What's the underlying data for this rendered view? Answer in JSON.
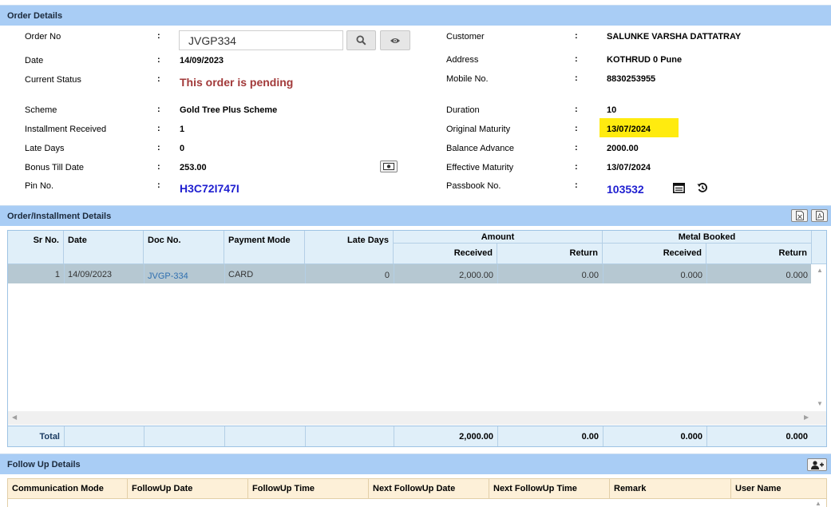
{
  "order_details": {
    "title": "Order Details",
    "order_no_label": "Order No",
    "order_no_value": "JVGP334",
    "date_label": "Date",
    "date_value": "14/09/2023",
    "status_label": "Current Status",
    "status_value": "This order is pending",
    "scheme_label": "Scheme",
    "scheme_value": "Gold Tree Plus Scheme",
    "installment_label": "Installment Received",
    "installment_value": "1",
    "late_days_label": "Late Days",
    "late_days_value": "0",
    "bonus_label": "Bonus Till Date",
    "bonus_value": "253.00",
    "pin_label": "Pin No.",
    "pin_value": "H3C72I747I",
    "customer_label": "Customer",
    "customer_value": "SALUNKE VARSHA DATTATRAY",
    "address_label": "Address",
    "address_value": "KOTHRUD 0 Pune",
    "mobile_label": "Mobile No.",
    "mobile_value": "8830253955",
    "duration_label": "Duration",
    "duration_value": "10",
    "original_maturity_label": "Original Maturity",
    "original_maturity_value": "13/07/2024",
    "balance_label": "Balance Advance",
    "balance_value": "2000.00",
    "effective_maturity_label": "Effective Maturity",
    "effective_maturity_value": "13/07/2024",
    "passbook_label": "Passbook No.",
    "passbook_value": "103532",
    "colon": ":",
    "highlight_color": "#ffeb0f"
  },
  "installment_details": {
    "title": "Order/Installment Details",
    "headers": {
      "sr_no": "Sr No.",
      "date": "Date",
      "doc_no": "Doc No.",
      "payment_mode": "Payment Mode",
      "late_days": "Late Days",
      "amount": "Amount",
      "metal_booked": "Metal Booked",
      "received": "Received",
      "return": "Return"
    },
    "rows": [
      {
        "sr_no": "1",
        "date": "14/09/2023",
        "doc_no": "JVGP-334",
        "payment_mode": "CARD",
        "late_days": "0",
        "amount_received": "2,000.00",
        "amount_return": "0.00",
        "metal_received": "0.000",
        "metal_return": "0.000"
      }
    ],
    "total": {
      "label": "Total",
      "amount_received": "2,000.00",
      "amount_return": "0.00",
      "metal_received": "0.000",
      "metal_return": "0.000"
    }
  },
  "follow_up": {
    "title": "Follow Up Details",
    "headers": [
      "Communication Mode",
      "FollowUp Date",
      "FollowUp Time",
      "Next FollowUp Date",
      "Next FollowUp Time",
      "Remark",
      "User Name"
    ]
  }
}
